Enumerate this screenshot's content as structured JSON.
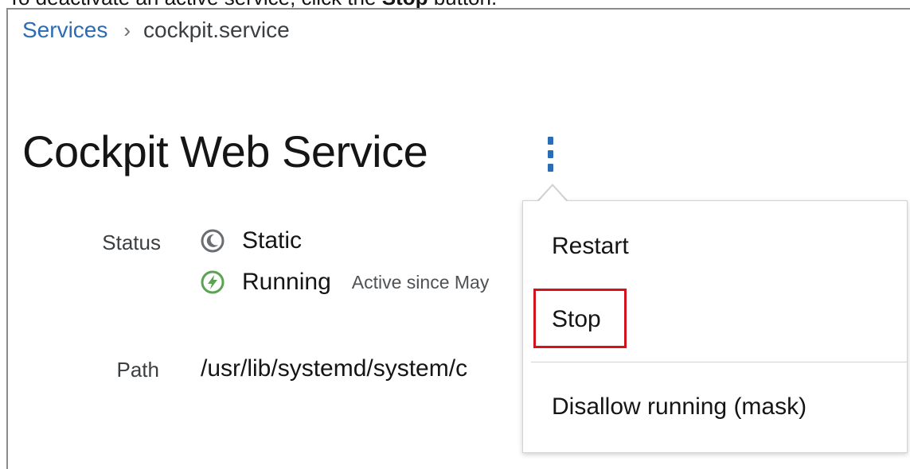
{
  "caption": {
    "prefix": "To deactivate an active service, click the",
    "bold": "Stop",
    "suffix": "button."
  },
  "breadcrumb": {
    "parent": "Services",
    "separator": "›",
    "current": "cockpit.service"
  },
  "page": {
    "title": "Cockpit Web Service"
  },
  "details": {
    "status_label": "Status",
    "status_static": "Static",
    "status_running": "Running",
    "status_running_since": "Active since May",
    "path_label": "Path",
    "path_value": "/usr/lib/systemd/system/c"
  },
  "menu": {
    "items": [
      {
        "label": "Restart"
      },
      {
        "label": "Stop"
      },
      {
        "label": "Disallow running (mask)"
      }
    ]
  },
  "colors": {
    "link": "#2b6cb5",
    "running_icon": "#5ba352",
    "static_icon": "#6a6e73",
    "highlight": "#d4121e"
  },
  "icons": {
    "static": "moon-circle-icon",
    "running": "lightning-circle-icon",
    "kebab": "kebab-menu-icon"
  }
}
